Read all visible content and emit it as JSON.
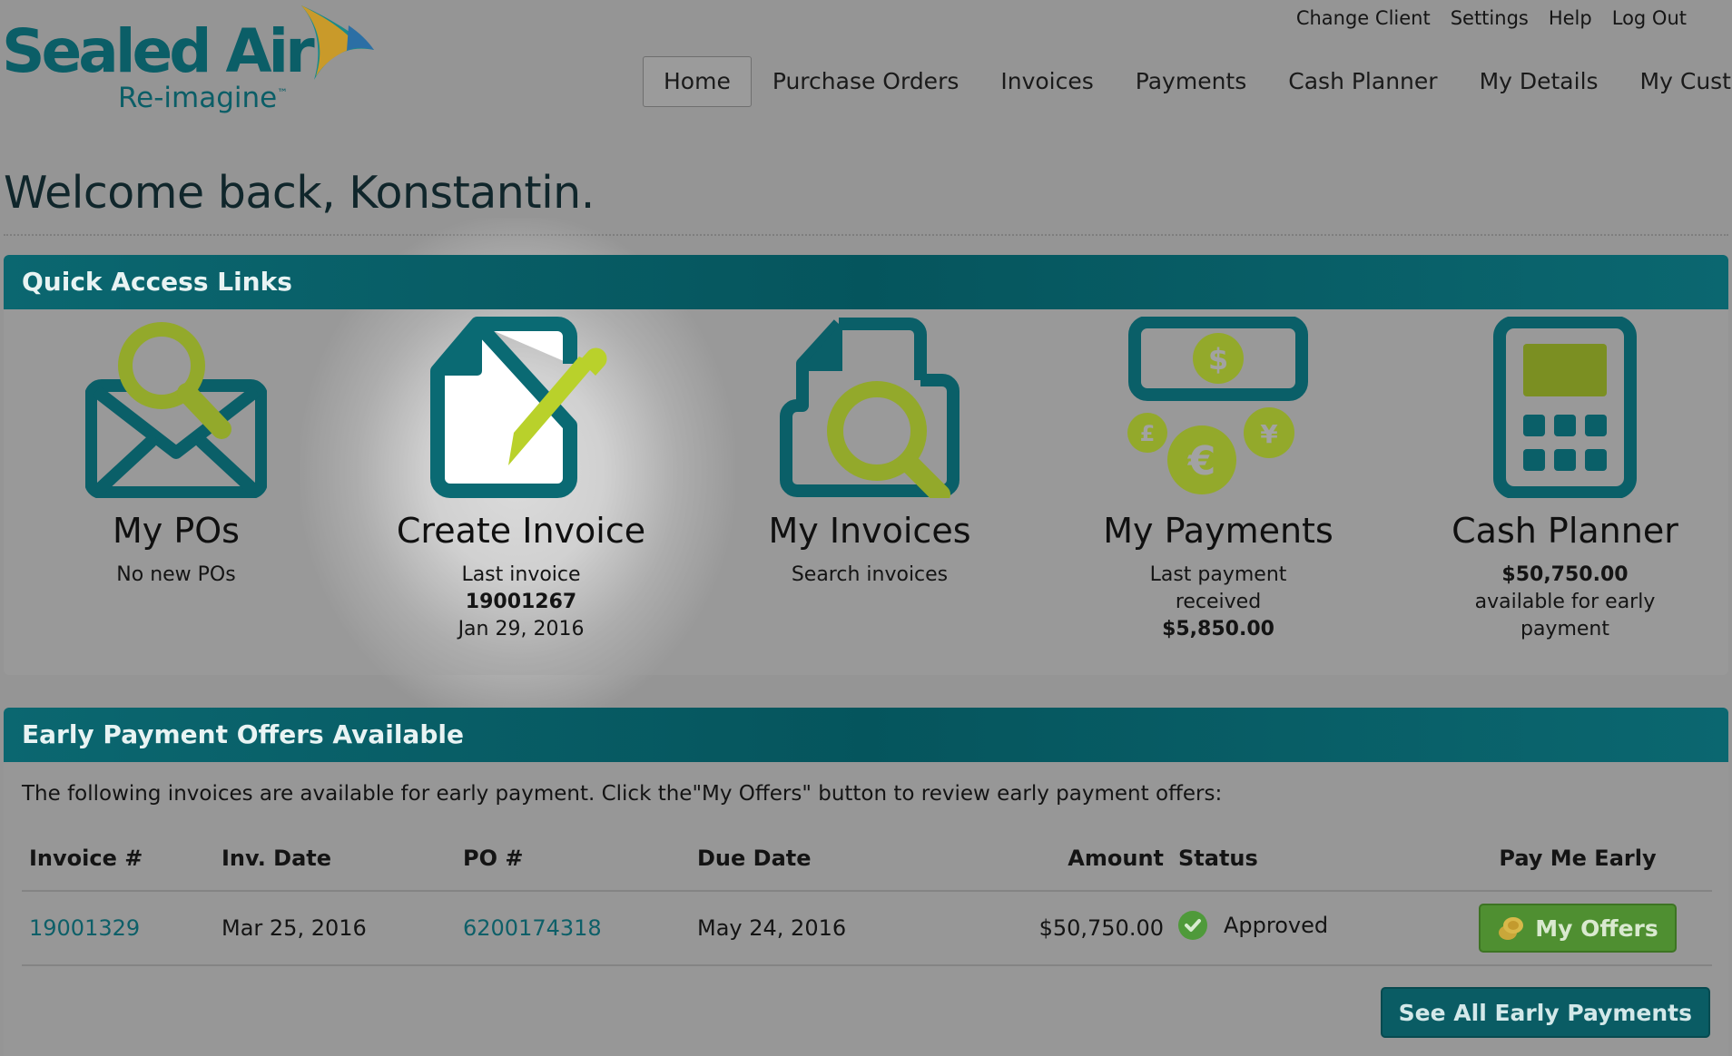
{
  "brand": {
    "name": "Sealed Air",
    "tagline": "Re-imagine",
    "trademark": "™"
  },
  "util_nav": [
    "Change Client",
    "Settings",
    "Help",
    "Log Out"
  ],
  "main_nav": [
    {
      "label": "Home",
      "active": true
    },
    {
      "label": "Purchase Orders",
      "active": false
    },
    {
      "label": "Invoices",
      "active": false
    },
    {
      "label": "Payments",
      "active": false
    },
    {
      "label": "Cash Planner",
      "active": false
    },
    {
      "label": "My Details",
      "active": false
    },
    {
      "label": "My Customer",
      "active": false
    }
  ],
  "welcome": "Welcome back, Konstantin.",
  "quick_access": {
    "title": "Quick Access Links",
    "tiles": {
      "my_pos": {
        "title": "My POs",
        "icon": "envelope-search-icon",
        "line1": "No new POs"
      },
      "create_invoice": {
        "title": "Create Invoice",
        "icon": "document-pencil-icon",
        "line1": "Last invoice",
        "line2": "19001267",
        "line3": "Jan 29, 2016"
      },
      "my_invoices": {
        "title": "My Invoices",
        "icon": "document-search-icon",
        "line1": "Search invoices"
      },
      "my_payments": {
        "title": "My Payments",
        "icon": "currency-icon",
        "line1": "Last payment",
        "line2": "received",
        "line3": "$5,850.00"
      },
      "cash_planner": {
        "title": "Cash Planner",
        "icon": "calculator-icon",
        "line1": "$50,750.00",
        "line2": "available for early",
        "line3": "payment"
      }
    }
  },
  "early_payment": {
    "title": "Early Payment Offers Available",
    "intro": "The following invoices are available for early payment. Click the\"My Offers\" button to review early payment offers:",
    "columns": {
      "invoice": "Invoice #",
      "inv_date": "Inv. Date",
      "po": "PO #",
      "due_date": "Due Date",
      "amount": "Amount",
      "status": "Status",
      "pay_me_early": "Pay Me Early"
    },
    "rows": [
      {
        "invoice": "19001329",
        "inv_date": "Mar 25, 2016",
        "po": "6200174318",
        "due_date": "May 24, 2016",
        "amount": "$50,750.00",
        "status": "Approved",
        "action": "My Offers"
      }
    ],
    "see_all": "See All Early Payments"
  },
  "colors": {
    "teal": "#0b6770",
    "lime": "#a5b92c",
    "green_button": "#4f8f31",
    "background": "#959595"
  }
}
